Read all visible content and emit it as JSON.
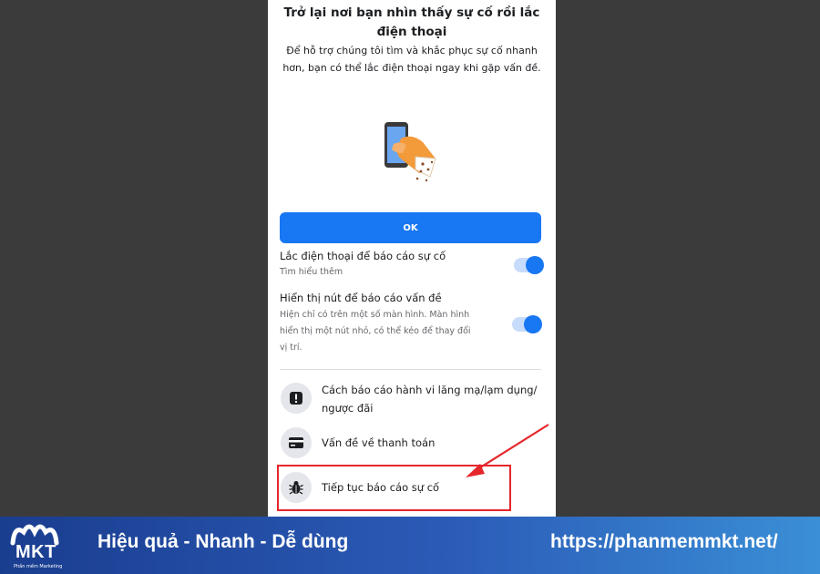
{
  "dialog": {
    "title_line1": "Trở lại nơi bạn nhìn thấy sự cố rồi lắc",
    "title_line2": "điện thoại",
    "description": "Để hỗ trợ chúng tôi tìm và khắc phục sự cố nhanh hơn, bạn có thể lắc điện thoại ngay khi gặp vấn đề.",
    "illustration_icon": "hand-shaking-phone-icon",
    "ok_label": "OK"
  },
  "settings": [
    {
      "title": "Lắc điện thoại để báo cáo sự cố",
      "subtitle_lines": [
        "Tìm hiểu thêm"
      ],
      "toggle_on": true
    },
    {
      "title": "Hiển thị nút để báo cáo vấn đề",
      "subtitle_lines": [
        "Hiện chỉ có trên một số màn hình. Màn hình",
        "hiển thị một nút nhỏ, có thể kéo để thay đổi",
        "vị trí."
      ],
      "toggle_on": true
    }
  ],
  "menu": [
    {
      "icon": "exclamation-icon",
      "label_lines": [
        "Cách báo cáo hành vi lăng mạ/lạm dụng/",
        "ngược đãi"
      ]
    },
    {
      "icon": "credit-card-icon",
      "label_lines": [
        "Vấn đề về thanh toán"
      ]
    },
    {
      "icon": "bug-icon",
      "label_lines": [
        "Tiếp tục báo cáo sự cố"
      ]
    }
  ],
  "annotation": {
    "color": "#e5262b"
  },
  "footer": {
    "logo_text": "MKT",
    "logo_subtext": "Phần mềm Marketing",
    "tagline": "Hiệu quả - Nhanh - Dễ dùng",
    "url": "https://phanmemmkt.net/"
  },
  "colors": {
    "accent": "#1877f2",
    "background": "#3b3b3c",
    "footer": "#2b5bb7"
  }
}
